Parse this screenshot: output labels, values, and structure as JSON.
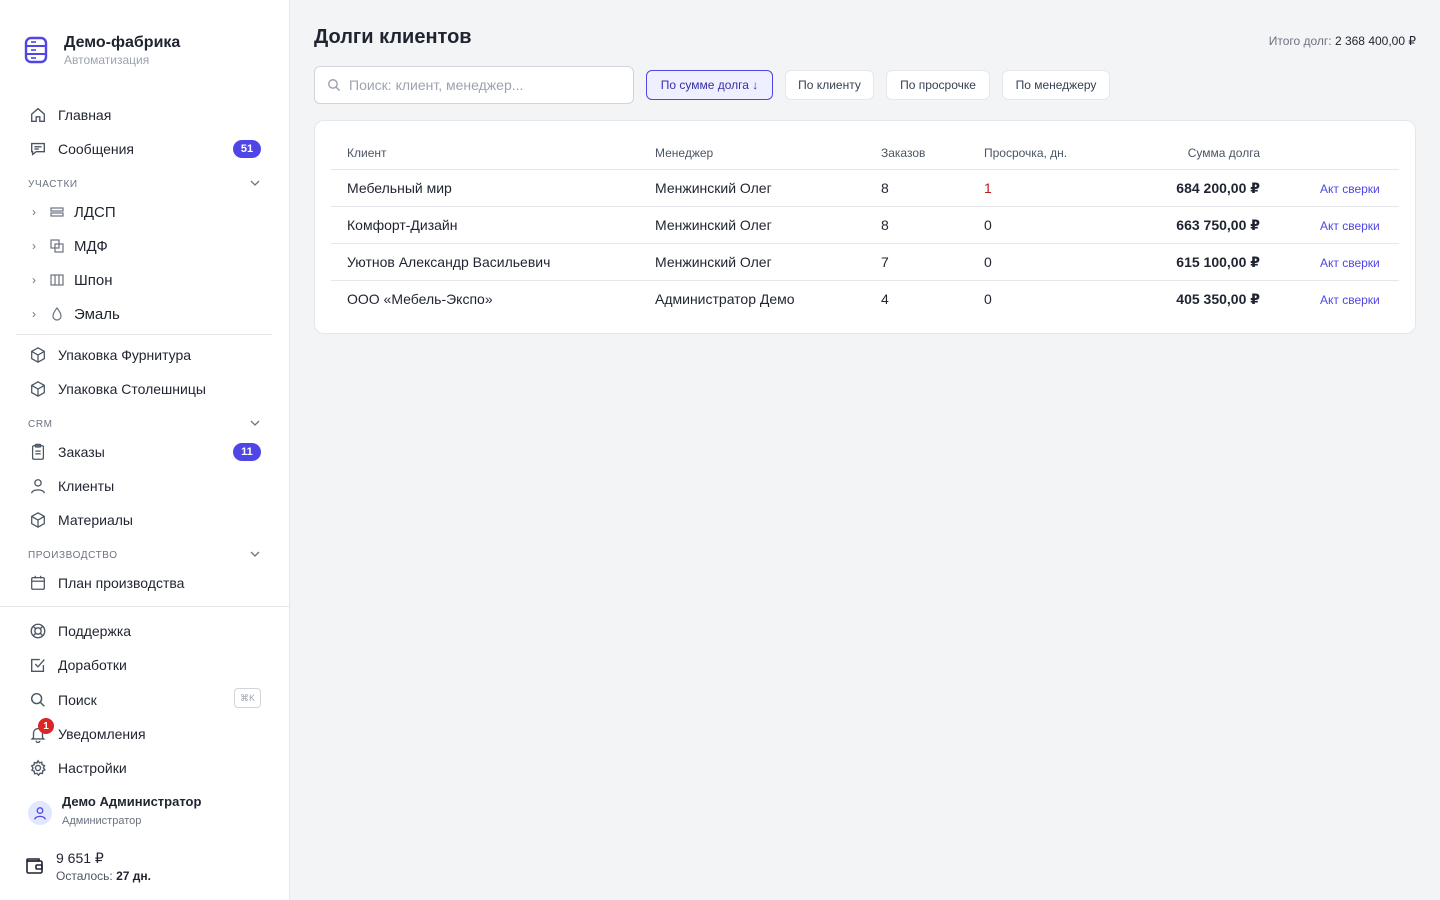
{
  "brand": {
    "title": "Демо-фабрика",
    "subtitle": "Автоматизация"
  },
  "nav": {
    "home": "Главная",
    "messages": {
      "label": "Сообщения",
      "badge": "51"
    },
    "section_parts": "УЧАСТКИ",
    "parts": [
      {
        "label": "ЛДСП",
        "icon": "layers-icon"
      },
      {
        "label": "МДФ",
        "icon": "squares-icon"
      },
      {
        "label": "Шпон",
        "icon": "grid-icon"
      },
      {
        "label": "Эмаль",
        "icon": "drop-icon"
      }
    ],
    "packaging": [
      "Упаковка Фурнитура",
      "Упаковка Столешницы"
    ],
    "section_crm": "CRM",
    "orders": {
      "label": "Заказы",
      "badge": "11"
    },
    "clients": "Клиенты",
    "materials": "Материалы",
    "section_production": "ПРОИЗВОДСТВО",
    "production_plan": "План производства",
    "support": "Поддержка",
    "improvements": "Доработки",
    "search": {
      "label": "Поиск",
      "shortcut": "⌘K"
    },
    "notifications": {
      "label": "Уведомления",
      "badge": "1"
    },
    "settings": "Настройки"
  },
  "user": {
    "name": "Демо Администратор",
    "role": "Администратор"
  },
  "balance": {
    "amount": "9 651 ₽",
    "rest_label": "Осталось:",
    "rest_value": "27 дн."
  },
  "page": {
    "title": "Долги клиентов",
    "total_label": "Итого долг:",
    "total_value": "2 368 400,00 ₽"
  },
  "search": {
    "placeholder": "Поиск: клиент, менеджер..."
  },
  "sort_buttons": [
    {
      "label": "По сумме долга ↓",
      "active": true
    },
    {
      "label": "По клиенту",
      "active": false
    },
    {
      "label": "По просрочке",
      "active": false
    },
    {
      "label": "По менеджеру",
      "active": false
    }
  ],
  "table": {
    "headers": [
      "Клиент",
      "Менеджер",
      "Заказов",
      "Просрочка, дн.",
      "Сумма долга"
    ],
    "rows": [
      {
        "client": "Мебельный мир",
        "manager": "Менжинский Олег",
        "orders": "8",
        "overdue": "1",
        "amount": "684 200,00 ₽",
        "action": "Акт сверки"
      },
      {
        "client": "Комфорт-Дизайн",
        "manager": "Менжинский Олег",
        "orders": "8",
        "overdue": "0",
        "amount": "663 750,00 ₽",
        "action": "Акт сверки"
      },
      {
        "client": "Уютнов Александр Васильевич",
        "manager": "Менжинский Олег",
        "orders": "7",
        "overdue": "0",
        "amount": "615 100,00 ₽",
        "action": "Акт сверки"
      },
      {
        "client": "ООО «Мебель-Экспо»",
        "manager": "Администратор Демо",
        "orders": "4",
        "overdue": "0",
        "amount": "405 350,00 ₽",
        "action": "Акт сверки"
      }
    ]
  },
  "colors": {
    "accent": "#4f46e5",
    "danger": "#b91c1c",
    "background": "#f3f4f6"
  }
}
